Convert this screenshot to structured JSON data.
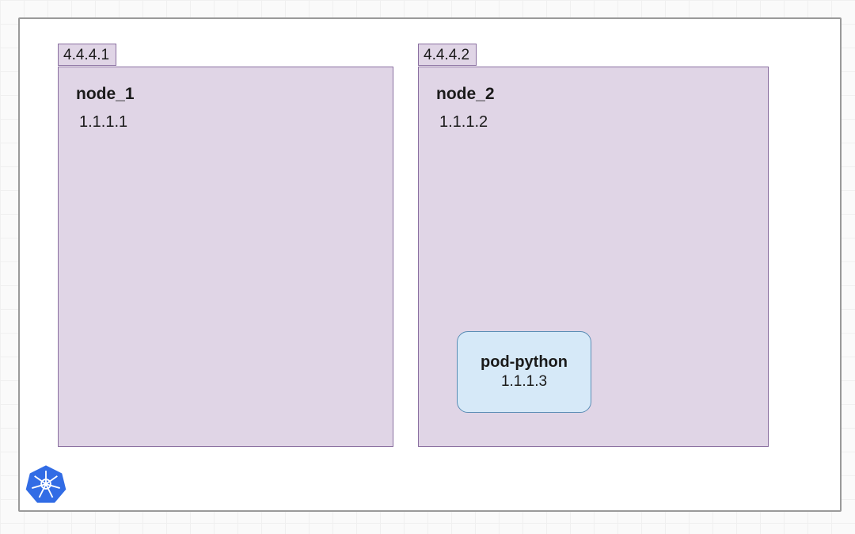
{
  "cluster": {
    "nodes": [
      {
        "external_ip": "4.4.4.1",
        "name": "node_1",
        "internal_ip": "1.1.1.1",
        "pods": []
      },
      {
        "external_ip": "4.4.4.2",
        "name": "node_2",
        "internal_ip": "1.1.1.2",
        "pods": [
          {
            "name": "pod-python",
            "ip": "1.1.1.3"
          }
        ]
      }
    ]
  },
  "colors": {
    "node_fill": "#e0d5e6",
    "node_border": "#8a6fa0",
    "pod_fill": "#d6e9f8",
    "pod_border": "#5a8db5",
    "k8s_blue": "#326ce5"
  }
}
